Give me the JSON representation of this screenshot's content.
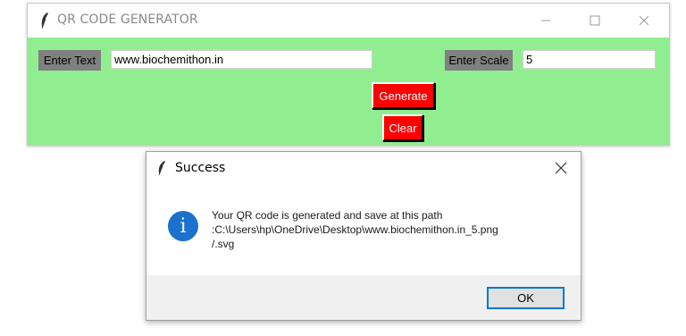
{
  "main_window": {
    "title": "QR CODE GENERATOR",
    "enter_text_label": "Enter Text",
    "text_value": "www.biochemithon.in",
    "enter_scale_label": "Enter Scale",
    "scale_value": "5",
    "generate_label": "Generate",
    "clear_label": "Clear"
  },
  "dialog": {
    "title": "Success",
    "message_lines": [
      "Your QR code is generated and save at this path",
      ":C:\\Users\\hp\\OneDrive\\Desktop\\www.biochemithon.in_5.png",
      "/.svg"
    ],
    "info_glyph": "i",
    "ok_label": "OK"
  },
  "colors": {
    "window_bg": "#90ee90",
    "label_bg": "#808080",
    "button_bg": "#ff0000",
    "info_icon": "#1a72cc",
    "ok_border": "#0078d7"
  },
  "icons": [
    "feather-icon",
    "minimize-icon",
    "maximize-icon",
    "close-icon",
    "info-icon"
  ]
}
